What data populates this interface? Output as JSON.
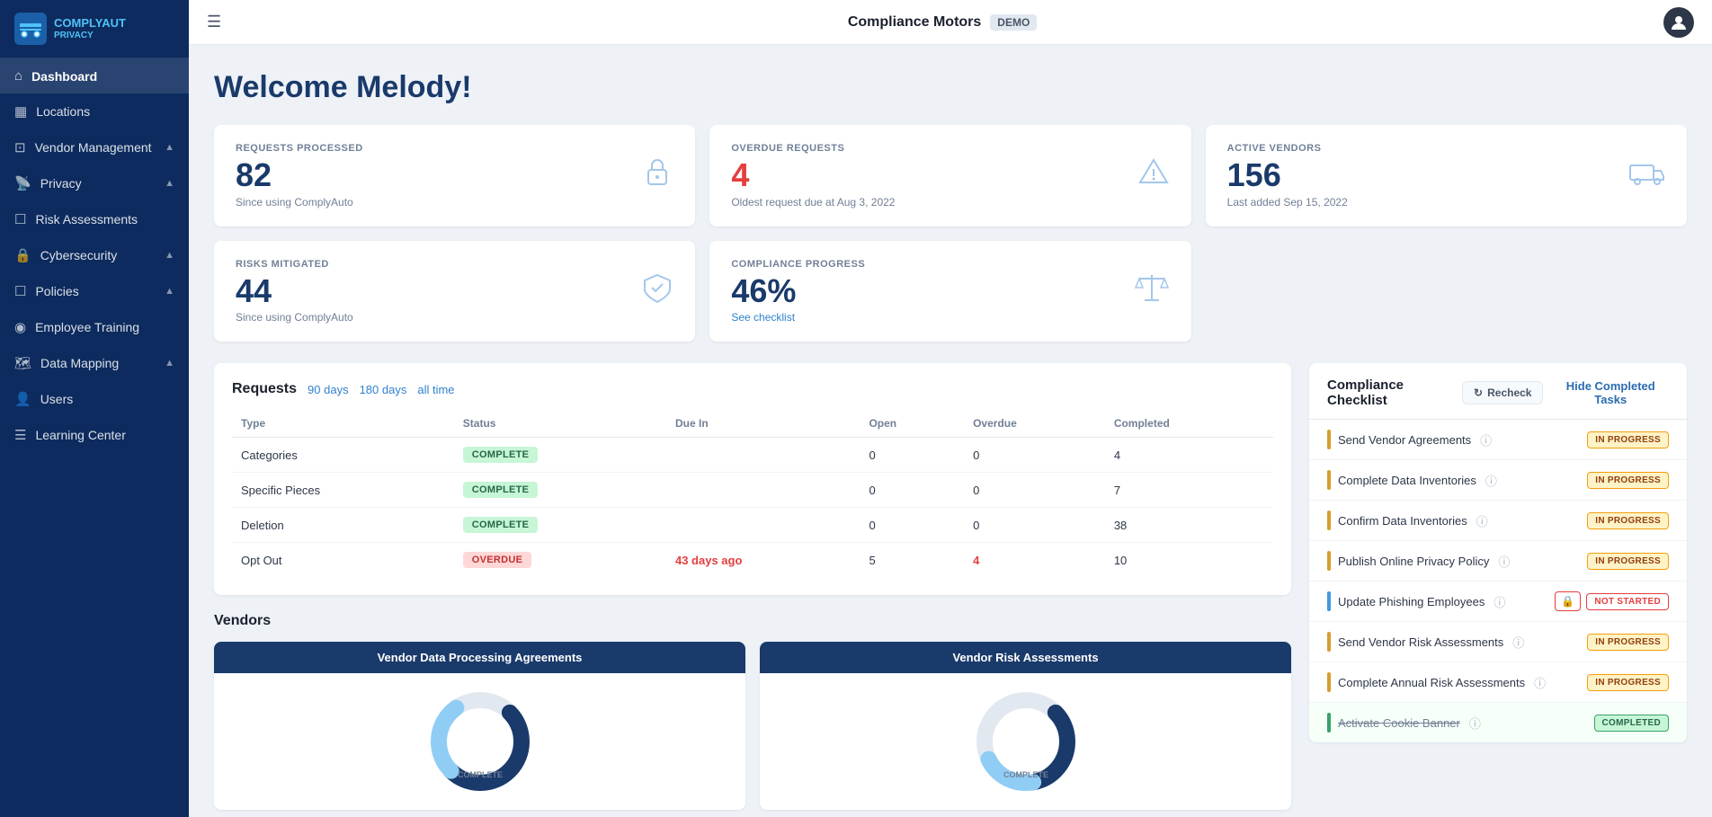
{
  "sidebar": {
    "logo_text1": "COMPLYAUT",
    "logo_text2": "PRIVACY",
    "items": [
      {
        "id": "dashboard",
        "label": "Dashboard",
        "icon": "⊞",
        "active": true,
        "expandable": false
      },
      {
        "id": "locations",
        "label": "Locations",
        "icon": "▦",
        "active": false,
        "expandable": false
      },
      {
        "id": "vendor-management",
        "label": "Vendor Management",
        "icon": "⊡",
        "active": false,
        "expandable": true
      },
      {
        "id": "privacy",
        "label": "Privacy",
        "icon": "📡",
        "active": false,
        "expandable": true
      },
      {
        "id": "risk-assessments",
        "label": "Risk Assessments",
        "icon": "☐",
        "active": false,
        "expandable": false
      },
      {
        "id": "cybersecurity",
        "label": "Cybersecurity",
        "icon": "🔒",
        "active": false,
        "expandable": true
      },
      {
        "id": "policies",
        "label": "Policies",
        "icon": "☐",
        "active": false,
        "expandable": true
      },
      {
        "id": "employee-training",
        "label": "Employee Training",
        "icon": "◯",
        "active": false,
        "expandable": false
      },
      {
        "id": "data-mapping",
        "label": "Data Mapping",
        "icon": "🗺",
        "active": false,
        "expandable": true
      },
      {
        "id": "users",
        "label": "Users",
        "icon": "👤",
        "active": false,
        "expandable": false
      },
      {
        "id": "learning-center",
        "label": "Learning Center",
        "icon": "☰",
        "active": false,
        "expandable": false
      }
    ]
  },
  "topbar": {
    "company": "Compliance Motors",
    "demo_label": "DEMO",
    "menu_icon": "☰"
  },
  "welcome": {
    "heading": "Welcome Melody!"
  },
  "stats": {
    "requests_processed": {
      "label": "REQUESTS PROCESSED",
      "value": "82",
      "sub": "Since using ComplyAuto",
      "icon": "🔒"
    },
    "overdue_requests": {
      "label": "OVERDUE REQUESTS",
      "value": "4",
      "sub": "Oldest request due at Aug 3, 2022",
      "icon": "⚠"
    },
    "active_vendors": {
      "label": "ACTIVE VENDORS",
      "value": "156",
      "sub": "Last added Sep 15, 2022",
      "icon": "🚛"
    },
    "risks_mitigated": {
      "label": "RISKS MITIGATED",
      "value": "44",
      "sub": "Since using ComplyAuto",
      "icon": "🛡"
    },
    "compliance_progress": {
      "label": "COMPLIANCE PROGRESS",
      "value": "46%",
      "sub": "See checklist",
      "icon": "⚖"
    }
  },
  "requests": {
    "title": "Requests",
    "links": [
      "90 days",
      "180 days",
      "all time"
    ],
    "columns": [
      "Type",
      "Status",
      "Due In",
      "Open",
      "Overdue",
      "Completed"
    ],
    "rows": [
      {
        "type": "Categories",
        "status": "COMPLETE",
        "status_type": "complete",
        "due_in": "",
        "open": "0",
        "overdue": "0",
        "completed": "4"
      },
      {
        "type": "Specific Pieces",
        "status": "COMPLETE",
        "status_type": "complete",
        "due_in": "",
        "open": "0",
        "overdue": "0",
        "completed": "7"
      },
      {
        "type": "Deletion",
        "status": "COMPLETE",
        "status_type": "complete",
        "due_in": "",
        "open": "0",
        "overdue": "0",
        "completed": "38"
      },
      {
        "type": "Opt Out",
        "status": "OVERDUE",
        "status_type": "overdue",
        "due_in": "43 days ago",
        "open": "5",
        "overdue": "4",
        "completed": "10"
      }
    ]
  },
  "vendors": {
    "title": "Vendors",
    "charts": [
      {
        "id": "dpa",
        "label": "Vendor Data Processing Agreements",
        "bottom_label": "COMPLETE"
      },
      {
        "id": "vra",
        "label": "Vendor Risk Assessments",
        "bottom_label": "COMPLETE"
      }
    ]
  },
  "checklist": {
    "title": "Compliance Checklist",
    "recheck_label": "Recheck",
    "hide_completed_label": "Hide Completed Tasks",
    "items": [
      {
        "id": "send-vendor-agreements",
        "label": "Send Vendor Agreements",
        "bar": "yellow",
        "status": "IN PROGRESS",
        "status_type": "in-progress",
        "has_info": true
      },
      {
        "id": "complete-data-inventories",
        "label": "Complete Data Inventories",
        "bar": "yellow",
        "status": "IN PROGRESS",
        "status_type": "in-progress",
        "has_info": true
      },
      {
        "id": "confirm-data-inventories",
        "label": "Confirm Data Inventories",
        "bar": "yellow",
        "status": "IN PROGRESS",
        "status_type": "in-progress",
        "has_info": true
      },
      {
        "id": "publish-online-privacy-policy",
        "label": "Publish Online Privacy Policy",
        "bar": "yellow",
        "status": "IN PROGRESS",
        "status_type": "in-progress",
        "has_info": true
      },
      {
        "id": "update-phishing-employees",
        "label": "Update Phishing Employees",
        "bar": "blue",
        "status": "NOT STARTED",
        "status_type": "not-started",
        "has_info": true,
        "has_lock": true
      },
      {
        "id": "send-vendor-risk-assessments",
        "label": "Send Vendor Risk Assessments",
        "bar": "yellow",
        "status": "IN PROGRESS",
        "status_type": "in-progress",
        "has_info": true
      },
      {
        "id": "complete-annual-risk-assessments",
        "label": "Complete Annual Risk Assessments",
        "bar": "yellow",
        "status": "IN PROGRESS",
        "status_type": "in-progress",
        "has_info": true
      },
      {
        "id": "activate-cookie-banner",
        "label": "Activate Cookie Banner",
        "bar": "green",
        "status": "COMPLETED",
        "status_type": "completed",
        "has_info": true
      }
    ]
  },
  "icons": {
    "menu": "☰",
    "home": "⌂",
    "grid": "▦",
    "truck": "🚛",
    "wifi": "📡",
    "file": "☐",
    "lock": "🔒",
    "person": "👤",
    "book": "☰",
    "map": "🗺",
    "shield": "🛡",
    "warning": "⚠",
    "scale": "⚖",
    "refresh": "↻"
  }
}
